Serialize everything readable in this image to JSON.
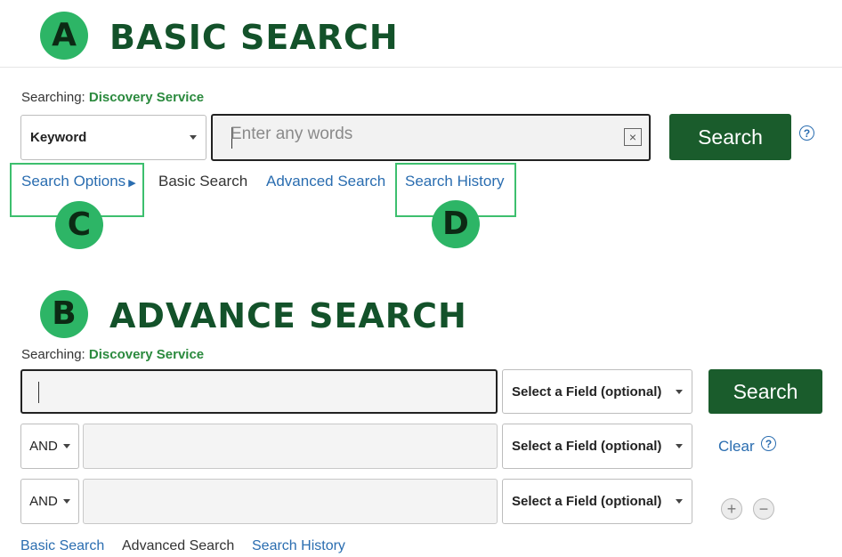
{
  "basic": {
    "badge": "A",
    "title": "BASIC SEARCH",
    "searching_label": "Searching:",
    "service": "Discovery Service",
    "field_select": "Keyword",
    "input_placeholder": "Enter any words",
    "search_button": "Search",
    "help": "?",
    "links": {
      "search_options": "Search Options",
      "basic_search": "Basic Search",
      "advanced_search": "Advanced Search",
      "search_history": "Search History"
    },
    "callout_c": "C",
    "callout_d": "D"
  },
  "advanced": {
    "badge": "B",
    "title": "ADVANCE SEARCH",
    "searching_label": "Searching:",
    "service": "Discovery Service",
    "rows": [
      {
        "operator": "",
        "field": "Select a Field (optional)"
      },
      {
        "operator": "AND",
        "field": "Select a Field (optional)"
      },
      {
        "operator": "AND",
        "field": "Select a Field (optional)"
      }
    ],
    "search_button": "Search",
    "clear": "Clear",
    "help": "?",
    "add": "+",
    "remove": "−",
    "links": {
      "basic_search": "Basic Search",
      "advanced_search": "Advanced Search",
      "search_history": "Search History"
    }
  },
  "colors": {
    "accent_green": "#2db566",
    "dark_green": "#1a5c2c",
    "title_green": "#13522a",
    "link_blue": "#2a6db0"
  }
}
